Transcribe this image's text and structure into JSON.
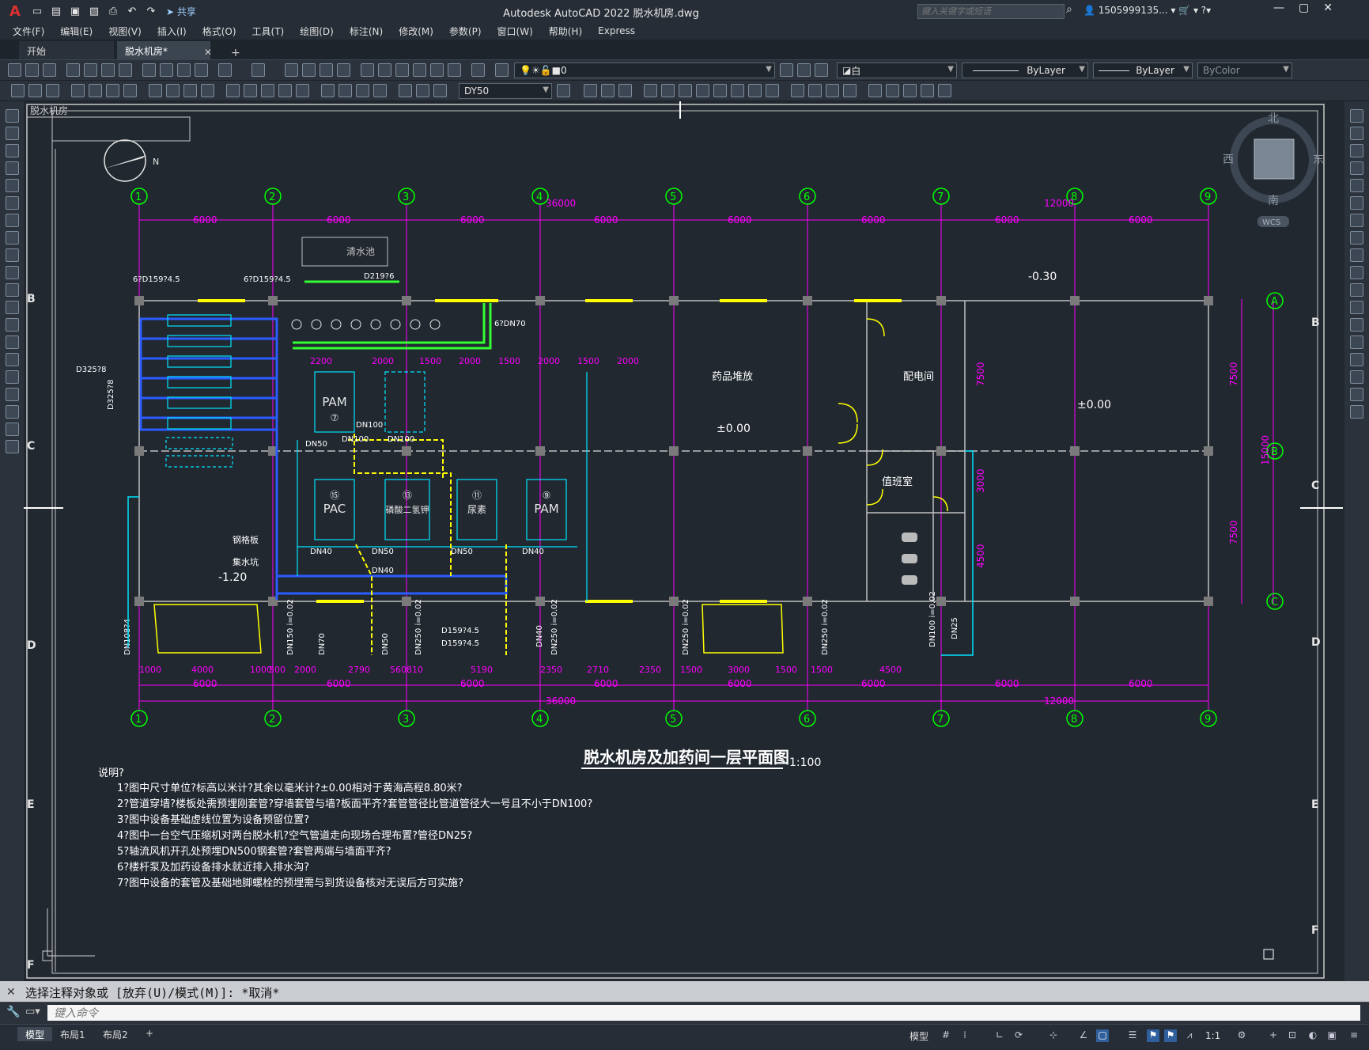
{
  "window": {
    "app_logo": "A",
    "title": "Autodesk AutoCAD 2022    脱水机房.dwg",
    "share_label": "共享",
    "search_placeholder": "键入关键字或短语",
    "user": "1505999135...",
    "controls": [
      "—",
      "▢",
      "✕"
    ]
  },
  "menu": [
    "文件(F)",
    "编辑(E)",
    "视图(V)",
    "插入(I)",
    "格式(O)",
    "工具(T)",
    "绘图(D)",
    "标注(N)",
    "修改(M)",
    "参数(P)",
    "窗口(W)",
    "帮助(H)",
    "Express"
  ],
  "tabs": {
    "start": "开始",
    "file": "脱水机房*",
    "close": "✕",
    "add": "+"
  },
  "toolbar": {
    "layer_value": "0",
    "color_value": "白",
    "linetype_value": "ByLayer",
    "lineweight_value": "ByLayer",
    "plotstyle_value": "ByColor",
    "dimstyle_value": "DY50"
  },
  "drawing": {
    "title": "脱水机房及加药间一层平面图",
    "scale": "1:100",
    "compass": {
      "north": "北",
      "south": "南",
      "west": "西",
      "east": "东",
      "wcs": "WCS",
      "n_mark": "N"
    },
    "top_grid": [
      "1",
      "2",
      "3",
      "4",
      "5",
      "6",
      "7",
      "8",
      "9"
    ],
    "bottom_grid": [
      "1",
      "2",
      "3",
      "4",
      "5",
      "6",
      "7",
      "8",
      "9"
    ],
    "right_grid": [
      "A",
      "B",
      "C"
    ],
    "border_letters": [
      "B",
      "C",
      "D",
      "E",
      "F"
    ],
    "dims_top": [
      "6000",
      "6000",
      "6000",
      "6000",
      "6000",
      "6000",
      "6000",
      "6000"
    ],
    "dim_top_total": "36000",
    "dim_top_right": "12000",
    "dims_bottom": [
      "6000",
      "6000",
      "6000",
      "6000",
      "6000",
      "6000",
      "6000",
      "6000"
    ],
    "dim_bottom_total": "36000",
    "dim_bottom_right": "12000",
    "dims_bottom_detail": [
      "1000",
      "4000",
      "1000",
      "500",
      "2000",
      "2790",
      "560",
      "810",
      "5190",
      "2350",
      "2710",
      "2350",
      "1500",
      "3000",
      "1500",
      "1500",
      "4500"
    ],
    "dims_right": [
      "7500",
      "3000",
      "4500"
    ],
    "dims_far_right": [
      "7500",
      "7500",
      "15000"
    ],
    "dims_row": [
      "2200",
      "2000",
      "1500",
      "2000",
      "1500",
      "2000",
      "1500",
      "2000"
    ],
    "room_labels": {
      "clear_pool": "清水池",
      "drug_storage": "药品堆放",
      "power_room": "配电间",
      "duty_room": "值班室",
      "pit": "集水坑",
      "checker": "钢格板"
    },
    "elevations": [
      "-0.30",
      "±0.00",
      "±0.00",
      "-1.20"
    ],
    "equipment": [
      "PAM",
      "PAC",
      "磷酸二氢钾",
      "尿素",
      "PAM"
    ],
    "equipment_nums": [
      "⑦",
      "⑮",
      "⑬",
      "⑪",
      "⑨"
    ],
    "pipe_labels": [
      "DN100",
      "DN100",
      "DN100",
      "DN50",
      "DN40",
      "DN50",
      "DN40",
      "DN50",
      "DN40",
      "6?DN70",
      "D325?8",
      "D325?8",
      "6?D159?4.5",
      "6?D159?4.5",
      "D219?6",
      "D159?4.5",
      "D159?4.5",
      "DN150 i=0.02",
      "DN250 i=0.02",
      "DN250 i=0.02",
      "DN250 i=0.02",
      "DN250 i=0.02",
      "DN100 i=0.02",
      "DN108?4",
      "DN70",
      "DN50",
      "DN40",
      "DN25"
    ],
    "notes_title": "说明?",
    "notes": [
      "1?图中尺寸单位?标高以米计?其余以毫米计?±0.00相对于黄海高程8.80米?",
      "2?管道穿墙?楼板处需预埋刚套管?穿墙套管与墙?板面平齐?套管管径比管道管径大一号且不小于DN100?",
      "3?图中设备基础虚线位置为设备预留位置?",
      "4?图中一台空气压缩机对两台脱水机?空气管道走向现场合理布置?管径DN25?",
      "5?轴流风机开孔处预埋DN500钢套管?套管两端与墙面平齐?",
      "6?楼杆泵及加药设备排水就近排入排水沟?",
      "7?图中设备的套管及基础地脚螺栓的预埋需与到货设备核对无误后方可实施?"
    ],
    "corner_label": "脱水机房"
  },
  "command": {
    "history": "选择注释对象或 [放弃(U)/模式(M)]: *取消*",
    "placeholder": "键入命令"
  },
  "status": {
    "model_tab": "模型",
    "layout1": "布局1",
    "layout2": "布局2",
    "add": "+",
    "model_btn": "模型",
    "scale": "1:1"
  },
  "colors": {
    "grid_line": "#ff00ff",
    "axis_bubble": "#00ff00",
    "wall": "#c0c0c0",
    "equipment": "#00e5ff",
    "pipe_yellow": "#ffff00",
    "pipe_blue": "#2b5cff",
    "pipe_green": "#33ff33",
    "background": "#212830"
  }
}
